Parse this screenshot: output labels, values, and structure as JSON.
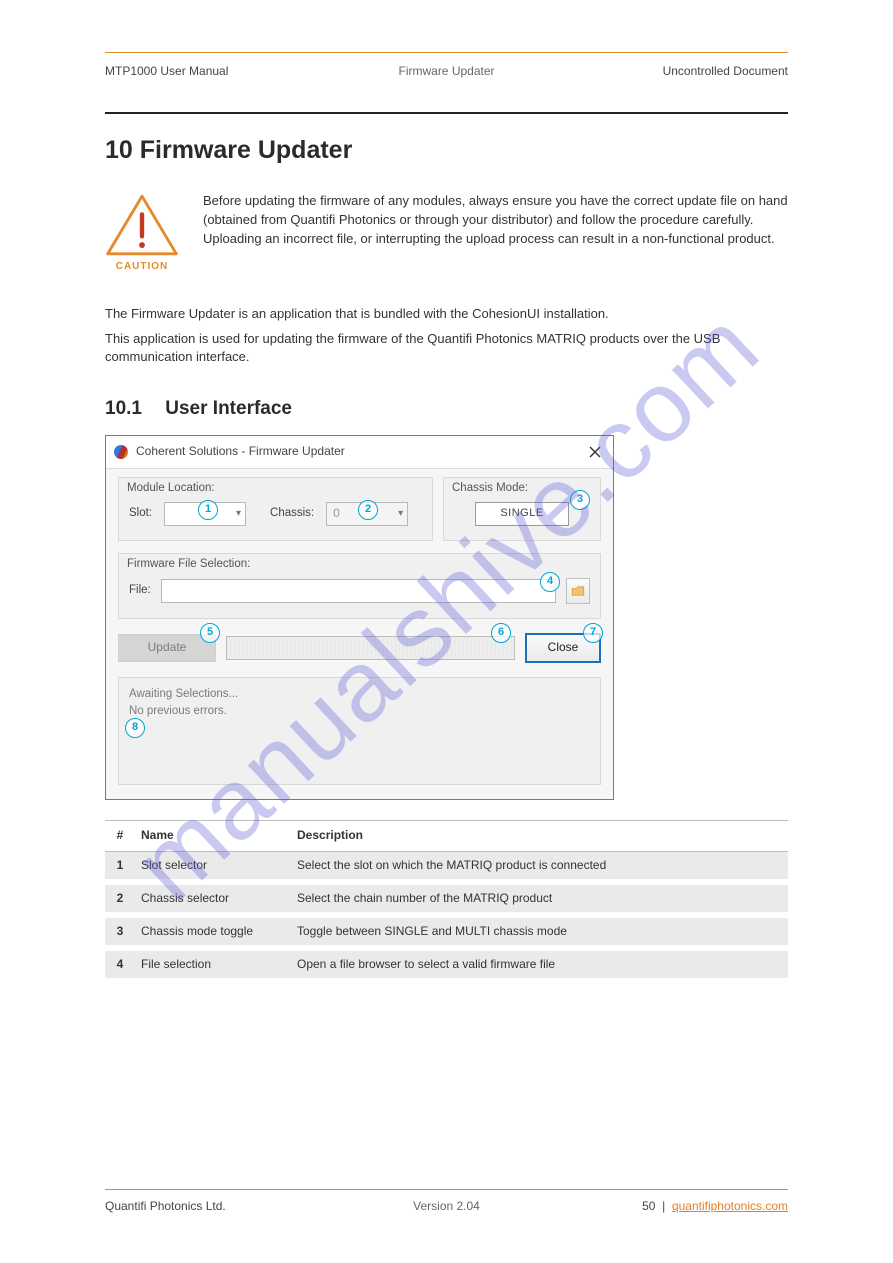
{
  "watermark_text": "manualshive.com",
  "nav": {
    "left": "MTP1000 User Manual",
    "center": "Firmware Updater",
    "right": "Uncontrolled Document"
  },
  "title": "10 Firmware Updater",
  "caution": {
    "label": "CAUTION",
    "text": "Before updating the firmware of any modules, always ensure you have the correct update file on hand (obtained from Quantifi Photonics or through your distributor) and follow the procedure carefully. Uploading an incorrect file, or interrupting the upload process can result in a non-functional product."
  },
  "intro1": "The Firmware Updater is an application that is bundled with the CohesionUI installation.",
  "intro2": "This application is used for updating the firmware of the Quantifi Photonics MATRIQ products over the USB communication interface.",
  "section": {
    "num": "10.1",
    "title": "User Interface"
  },
  "gui": {
    "title": "Coherent Solutions - Firmware Updater",
    "module_location_legend": "Module Location:",
    "slot_label": "Slot:",
    "slot_value": "",
    "chassis_label": "Chassis:",
    "chassis_value": "0",
    "chassis_mode_legend": "Chassis Mode:",
    "mode_button": "SINGLE",
    "file_legend": "Firmware File Selection:",
    "file_label": "File:",
    "file_value": "",
    "update_label": "Update",
    "close_label": "Close",
    "log_line1": "Awaiting Selections...",
    "log_line2": "No previous errors."
  },
  "pins": {
    "p1": "1",
    "p2": "2",
    "p3": "3",
    "p4": "4",
    "p5": "5",
    "p6": "6",
    "p7": "7",
    "p8": "8"
  },
  "table": {
    "head_num": "#",
    "head_name": "Name",
    "head_desc": "Description",
    "rows": [
      {
        "n": "1",
        "name": "Slot selector",
        "desc": "Select the slot on which the MATRIQ product is connected"
      },
      {
        "n": "2",
        "name": "Chassis selector",
        "desc": "Select the chain number of the MATRIQ product"
      },
      {
        "n": "3",
        "name": "Chassis mode toggle",
        "desc": "Toggle between SINGLE and MULTI chassis mode"
      },
      {
        "n": "4",
        "name": "File selection",
        "desc": "Open a file browser to select a valid firmware file"
      }
    ]
  },
  "footer": {
    "left": "Quantifi Photonics Ltd.",
    "center": "Version 2.04",
    "right_text": "50",
    "right_link": "quantifiphotonics.com"
  }
}
